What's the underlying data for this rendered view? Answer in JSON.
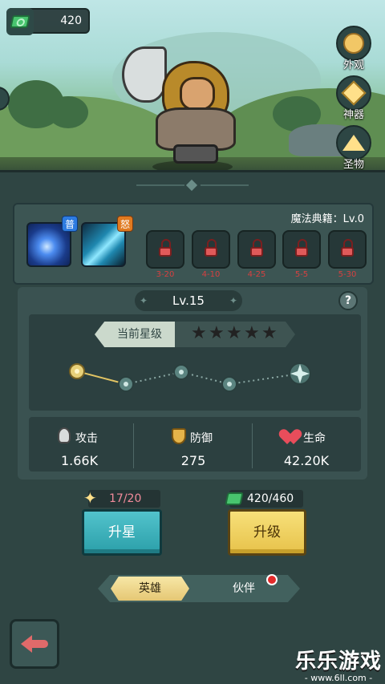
{
  "currency": {
    "gems": "420"
  },
  "side_menu": [
    {
      "label": "外观",
      "icon": "appearance-icon"
    },
    {
      "label": "神器",
      "icon": "artifact-icon"
    },
    {
      "label": "圣物",
      "icon": "relic-icon"
    }
  ],
  "skills": {
    "normal_tag": "普",
    "rage_tag": "怒",
    "book_label": "魔法典籍：Lv.0",
    "locked_requirements": [
      "3-20",
      "4-10",
      "4-25",
      "5-5",
      "5-30"
    ]
  },
  "level": {
    "label": "Lv.15",
    "help": "?"
  },
  "stars": {
    "label": "当前星级",
    "count": 0,
    "max": 5
  },
  "attributes": [
    {
      "name": "攻击",
      "value": "1.66K"
    },
    {
      "name": "防御",
      "value": "275"
    },
    {
      "name": "生命",
      "value": "42.20K"
    }
  ],
  "upgrade": {
    "star_cost": "17/20",
    "star_button": "升星",
    "gem_cost": "420/460",
    "level_button": "升级"
  },
  "tabs": {
    "hero": "英雄",
    "partner": "伙伴"
  },
  "watermark": {
    "title": "乐乐游戏",
    "url": "- www.6ll.com -"
  },
  "colors": {
    "panel": "#2f4543",
    "accent_gold": "#e7c24a",
    "accent_teal": "#2b9fa9",
    "lock_red": "#d64040"
  }
}
